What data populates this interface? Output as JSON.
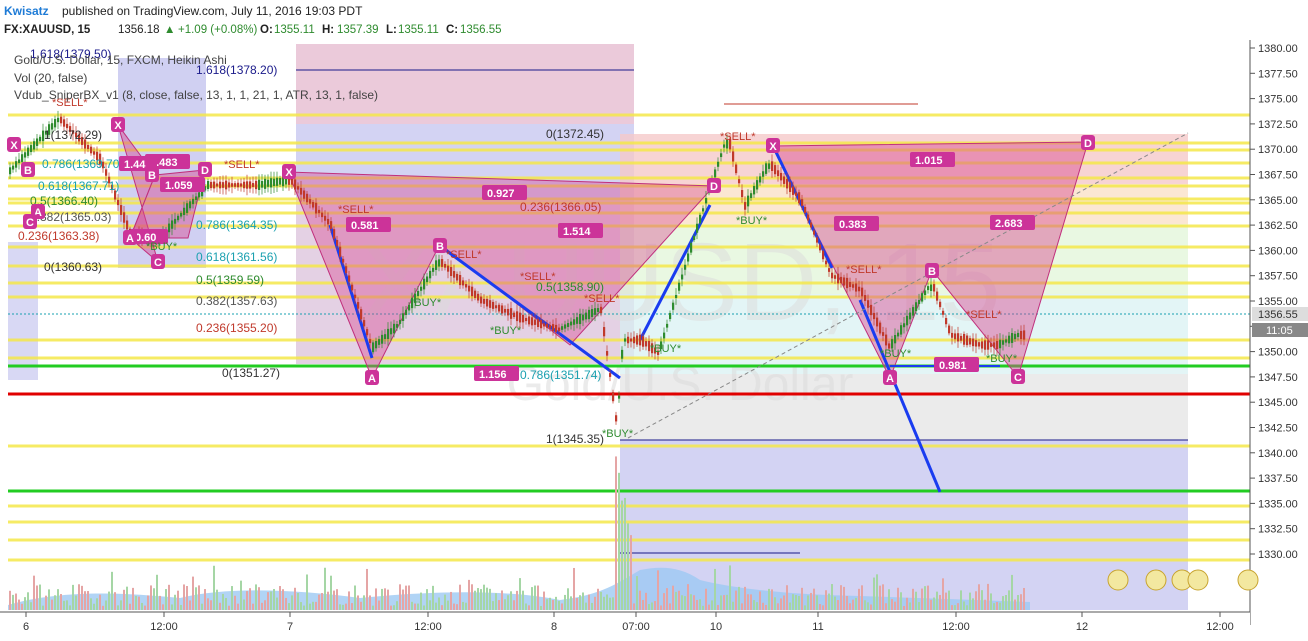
{
  "header": {
    "user": "Kwisatz",
    "published": "published on TradingView.com, July 11, 2016 19:03 PDT"
  },
  "ohlc": {
    "symbol": "FX:XAUUSD, 15",
    "price": "1356.18",
    "change": "+1.09 (+0.08%)",
    "o_label": "O:",
    "o": "1355.11",
    "h_label": "H:",
    "h": "1357.39",
    "l_label": "L:",
    "l": "1355.11",
    "c_label": "C:",
    "c": "1356.55"
  },
  "legend": {
    "series": "Gold/U.S. Dollar, 15, FXCM, Heikin Ashi",
    "vol": "Vol (20, false)",
    "indicator": "Vdub_SniperBX_v1 (8, close, false, 13, 1, 1, 21, 1, ATR, 13, 1, false)"
  },
  "watermark": {
    "big": "XAUUSD, 15",
    "small": "Gold/U.S. Dollar"
  },
  "colors": {
    "up": "#2e8b2e",
    "down": "#c0392b",
    "pattern": "#cc3399",
    "yellow": "#f5e84a",
    "green": "#22cc22",
    "red": "#e00000",
    "blue": "#1a3cf0"
  },
  "price_axis": {
    "ticks": [
      "1380.00",
      "1377.50",
      "1375.00",
      "1372.50",
      "1370.00",
      "1367.50",
      "1365.00",
      "1362.50",
      "1360.00",
      "1357.50",
      "1355.00",
      "1352.50",
      "1350.00",
      "1347.50",
      "1345.00",
      "1342.50",
      "1340.00",
      "1337.50",
      "1335.00",
      "1332.50",
      "1330.00"
    ],
    "current_price": "1356.55",
    "countdown": "11:05"
  },
  "time_axis": {
    "labels": [
      "6",
      "12:00",
      "7",
      "12:00",
      "8",
      "07:00",
      "10",
      "11",
      "12:00",
      "12",
      "12:00"
    ]
  },
  "fib_left": {
    "l1618": "1.618(1379.50)",
    "l1": "1(1372.29)",
    "l0786": "0.786(1369.70)",
    "l0618": "0.618(1367.71)",
    "l05": "0.5(1366.40)",
    "l0382": "0.382(1365.03)",
    "l0236": "0.236(1363.38)",
    "l0": "0(1360.63)"
  },
  "fib_mid": {
    "l1618": "1.618(1378.20)",
    "l0786": "0.786(1364.35)",
    "l0618": "0.618(1361.56)",
    "l05": "0.5(1359.59)",
    "l0382": "0.382(1357.63)",
    "l0236": "0.236(1355.20)",
    "l0": "0(1351.27)"
  },
  "fib_right": {
    "l0": "0(1372.45)",
    "l0236": "0.236(1366.05)",
    "l05": "0.5(1358.90)",
    "l0786": "0.786(1351.74)",
    "l1": "1(1345.35)"
  },
  "pattern_labels": {
    "r0483": "0.483",
    "r1059": "1.059",
    "r144": "1.44",
    "r060": "0.60",
    "r0581": "0.581",
    "r0927": "0.927",
    "r1514": "1.514",
    "r1156": "1.156",
    "r1015": "1.015",
    "r0383": "0.383",
    "r2683": "2.683",
    "r0981": "0.981"
  },
  "points": {
    "X": "X",
    "A": "A",
    "B": "B",
    "C": "C",
    "D": "D"
  },
  "signals": {
    "sell": "*SELL*",
    "buy": "*BUY*"
  }
}
